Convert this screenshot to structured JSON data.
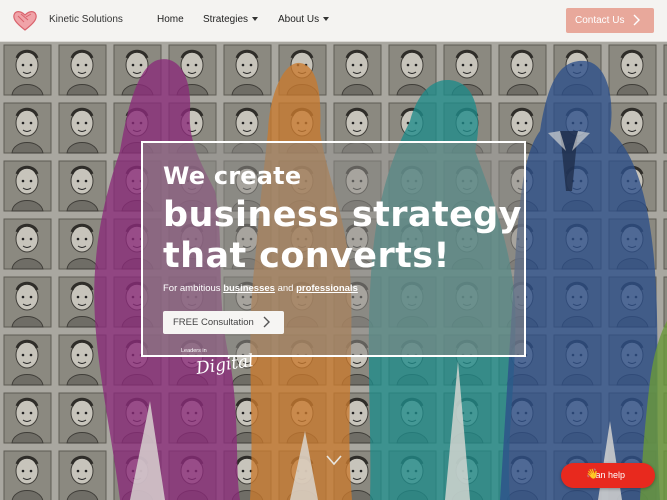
{
  "header": {
    "brand": "Kinetic Solutions",
    "nav": [
      {
        "label": "Home",
        "has_dropdown": false
      },
      {
        "label": "Strategies",
        "has_dropdown": true
      },
      {
        "label": "About Us",
        "has_dropdown": true
      }
    ],
    "contact_label": "Contact Us"
  },
  "hero": {
    "line_small": "We create",
    "line_big_1": "business strategy",
    "line_big_2": "that converts!",
    "sub_prefix": "For ambitious ",
    "sub_link_1": "businesses",
    "sub_mid": " and ",
    "sub_link_2": "professionals",
    "cta_label": "FREE Consultation",
    "badge_top": "Leaders in",
    "badge_script": "Digital"
  },
  "help": {
    "label": "can help",
    "icon": "waving-hand-icon"
  },
  "colors": {
    "header_bg": "#f4f3f1",
    "contact_bg": "#e8a89b",
    "help_bg": "#e8291e",
    "silhouette_magenta": "#8a2a7a",
    "silhouette_orange": "#c97a2e",
    "silhouette_teal": "#1f8c8a",
    "silhouette_blue": "#2d4f8a",
    "silhouette_green": "#6a9a3a"
  },
  "icons": [
    "heart-logo-icon",
    "chevron-right-icon",
    "caret-down-icon",
    "chevron-down-icon",
    "waving-hand-icon"
  ]
}
